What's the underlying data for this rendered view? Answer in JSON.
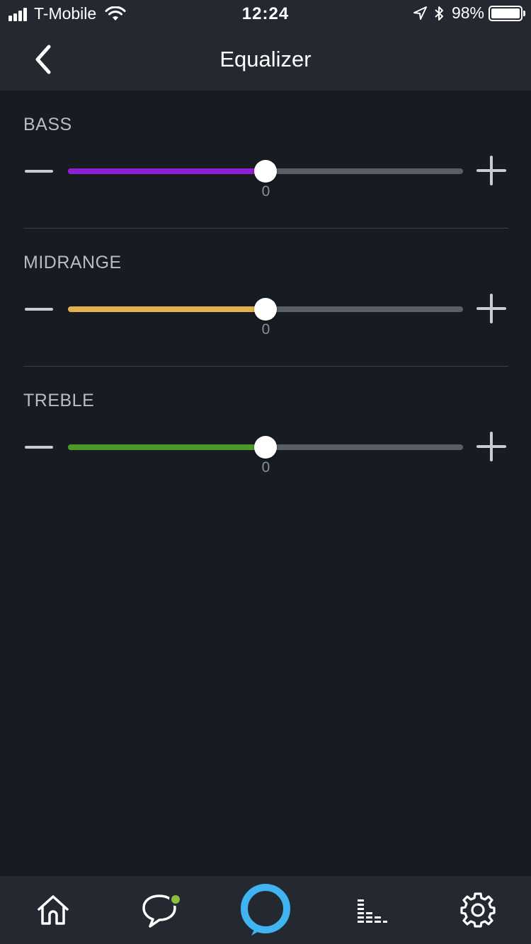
{
  "status_bar": {
    "carrier": "T-Mobile",
    "time": "12:24",
    "battery_percent": "98%",
    "icons": [
      "signal-icon",
      "wifi-icon",
      "location-icon",
      "bluetooth-icon",
      "battery-icon"
    ]
  },
  "header": {
    "title": "Equalizer",
    "back_icon": "chevron-left-icon"
  },
  "equalizer": {
    "bass": {
      "label": "BASS",
      "value": "0",
      "level_fraction": 0.5,
      "color": "#8f1fd1"
    },
    "midrange": {
      "label": "MIDRANGE",
      "value": "0",
      "level_fraction": 0.5,
      "color": "#e3b24a"
    },
    "treble": {
      "label": "TREBLE",
      "value": "0",
      "level_fraction": 0.5,
      "color": "#4c9a2a"
    }
  },
  "tabbar": {
    "items": [
      {
        "icon": "home-icon"
      },
      {
        "icon": "chat-bubble-icon",
        "has_notification": true,
        "notification_color": "#8bbd3a"
      },
      {
        "icon": "alexa-ring-icon",
        "color": "#3fb4f0"
      },
      {
        "icon": "music-bars-icon"
      },
      {
        "icon": "gear-icon"
      }
    ]
  }
}
